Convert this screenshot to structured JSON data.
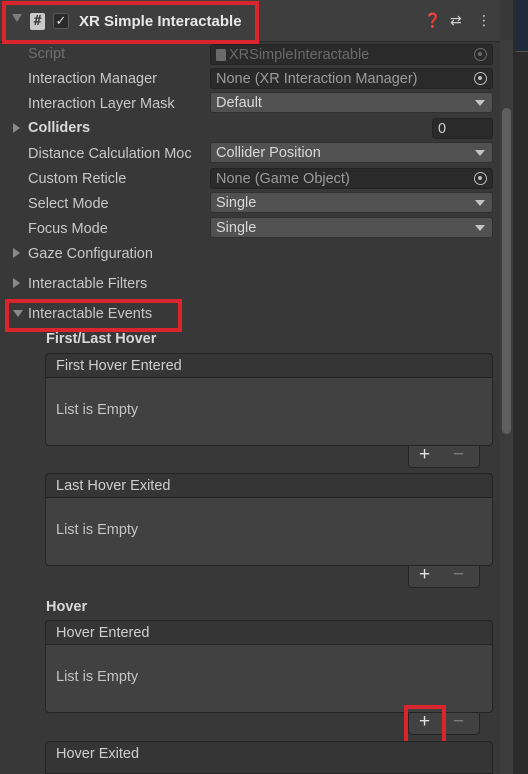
{
  "component": {
    "title": "XR Simple Interactable",
    "script_icon": "#",
    "check_glyph": "✓",
    "help_glyph": "❓",
    "preset_glyph": "⇄",
    "menu_glyph": "⋮"
  },
  "properties": {
    "script": {
      "label": "Script",
      "value": "XRSimpleInteractable"
    },
    "interaction_manager": {
      "label": "Interaction Manager",
      "value": "None (XR Interaction Manager)"
    },
    "layer_mask": {
      "label": "Interaction Layer Mask",
      "value": "Default"
    },
    "colliders": {
      "label": "Colliders",
      "value": "0"
    },
    "distance_calc": {
      "label": "Distance Calculation Moc",
      "value": "Collider Position"
    },
    "custom_reticle": {
      "label": "Custom Reticle",
      "value": "None (Game Object)"
    },
    "select_mode": {
      "label": "Select Mode",
      "value": "Single"
    },
    "focus_mode": {
      "label": "Focus Mode",
      "value": "Single"
    }
  },
  "foldouts": {
    "gaze_configuration": "Gaze Configuration",
    "interactable_filters": "Interactable Filters",
    "interactable_events": "Interactable Events"
  },
  "events": {
    "first_last_hover": "First/Last Hover",
    "hover": "Hover",
    "empty_text": "List is Empty",
    "plus": "+",
    "minus": "−",
    "first_hover_entered": "First Hover Entered",
    "last_hover_exited": "Last Hover Exited",
    "hover_entered": "Hover Entered",
    "hover_exited": "Hover Exited"
  },
  "colors": {
    "highlight": "#d9252b",
    "background": "#383838"
  }
}
